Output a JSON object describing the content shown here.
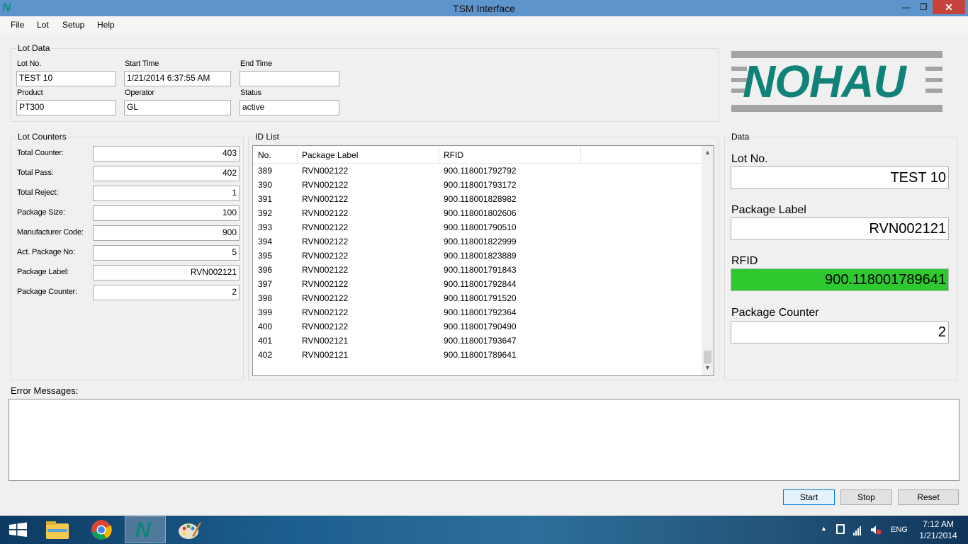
{
  "window": {
    "title": "TSM Interface",
    "app_icon": "N"
  },
  "menu": [
    "File",
    "Lot",
    "Setup",
    "Help"
  ],
  "lot_data": {
    "legend": "Lot Data",
    "lot_no_label": "Lot No.",
    "lot_no": "TEST 10",
    "start_time_label": "Start Time",
    "start_time": "1/21/2014 6:37:55 AM",
    "end_time_label": "End Time",
    "end_time": "",
    "product_label": "Product",
    "product": "PT300",
    "operator_label": "Operator",
    "operator": "GL",
    "status_label": "Status",
    "status": "active"
  },
  "logo": {
    "text": "NOHAU"
  },
  "lot_counters": {
    "legend": "Lot Counters",
    "rows": [
      {
        "label": "Total Counter:",
        "value": "403"
      },
      {
        "label": "Total Pass:",
        "value": "402"
      },
      {
        "label": "Total Reject:",
        "value": "1"
      },
      {
        "label": "Package Size:",
        "value": "100"
      },
      {
        "label": "Manufacturer Code:",
        "value": "900"
      },
      {
        "label": "Act. Package No:",
        "value": "5"
      },
      {
        "label": "Package Label:",
        "value": "RVN002121"
      },
      {
        "label": "Package Counter:",
        "value": "2"
      }
    ]
  },
  "id_list": {
    "legend": "ID List",
    "columns": [
      "No.",
      "Package Label",
      "RFID"
    ],
    "rows": [
      {
        "no": "389",
        "label": "RVN002122",
        "rfid": "900.118001792792"
      },
      {
        "no": "390",
        "label": "RVN002122",
        "rfid": "900.118001793172"
      },
      {
        "no": "391",
        "label": "RVN002122",
        "rfid": "900.118001828982"
      },
      {
        "no": "392",
        "label": "RVN002122",
        "rfid": "900.118001802606"
      },
      {
        "no": "393",
        "label": "RVN002122",
        "rfid": "900.118001790510"
      },
      {
        "no": "394",
        "label": "RVN002122",
        "rfid": "900.118001822999"
      },
      {
        "no": "395",
        "label": "RVN002122",
        "rfid": "900.118001823889"
      },
      {
        "no": "396",
        "label": "RVN002122",
        "rfid": "900.118001791843"
      },
      {
        "no": "397",
        "label": "RVN002122",
        "rfid": "900.118001792844"
      },
      {
        "no": "398",
        "label": "RVN002122",
        "rfid": "900.118001791520"
      },
      {
        "no": "399",
        "label": "RVN002122",
        "rfid": "900.118001792364"
      },
      {
        "no": "400",
        "label": "RVN002122",
        "rfid": "900.118001790490"
      },
      {
        "no": "401",
        "label": "RVN002121",
        "rfid": "900.118001793647"
      },
      {
        "no": "402",
        "label": "RVN002121",
        "rfid": "900.118001789641"
      }
    ]
  },
  "data_panel": {
    "legend": "Data",
    "lot_no_label": "Lot No.",
    "lot_no": "TEST 10",
    "package_label_label": "Package Label",
    "package_label": "RVN002121",
    "rfid_label": "RFID",
    "rfid": "900.118001789641",
    "rfid_status_color": "#2ec92e",
    "package_counter_label": "Package Counter",
    "package_counter": "2"
  },
  "errors": {
    "label": "Error Messages:",
    "text": ""
  },
  "buttons": {
    "start": "Start",
    "stop": "Stop",
    "reset": "Reset"
  },
  "taskbar": {
    "apps": [
      "start-icon",
      "file-explorer-icon",
      "chrome-icon",
      "tsm-app-icon",
      "paint-icon"
    ],
    "language": "ENG",
    "time": "7:12 AM",
    "date": "1/21/2014"
  }
}
